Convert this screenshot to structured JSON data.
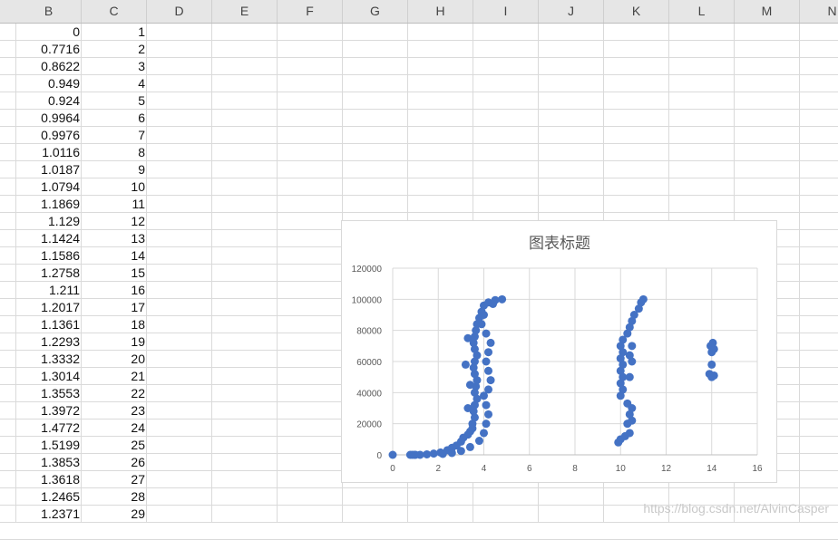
{
  "columns": [
    "B",
    "C",
    "D",
    "E",
    "F",
    "G",
    "H",
    "I",
    "J",
    "K",
    "L",
    "M",
    "N"
  ],
  "rows": [
    {
      "b": "0",
      "c": "1"
    },
    {
      "b": "0.7716",
      "c": "2"
    },
    {
      "b": "0.8622",
      "c": "3"
    },
    {
      "b": "0.949",
      "c": "4"
    },
    {
      "b": "0.924",
      "c": "5"
    },
    {
      "b": "0.9964",
      "c": "6"
    },
    {
      "b": "0.9976",
      "c": "7"
    },
    {
      "b": "1.0116",
      "c": "8"
    },
    {
      "b": "1.0187",
      "c": "9"
    },
    {
      "b": "1.0794",
      "c": "10"
    },
    {
      "b": "1.1869",
      "c": "11"
    },
    {
      "b": "1.129",
      "c": "12"
    },
    {
      "b": "1.1424",
      "c": "13"
    },
    {
      "b": "1.1586",
      "c": "14"
    },
    {
      "b": "1.2758",
      "c": "15"
    },
    {
      "b": "1.211",
      "c": "16"
    },
    {
      "b": "1.2017",
      "c": "17"
    },
    {
      "b": "1.1361",
      "c": "18"
    },
    {
      "b": "1.2293",
      "c": "19"
    },
    {
      "b": "1.3332",
      "c": "20"
    },
    {
      "b": "1.3014",
      "c": "21"
    },
    {
      "b": "1.3553",
      "c": "22"
    },
    {
      "b": "1.3972",
      "c": "23"
    },
    {
      "b": "1.4772",
      "c": "24"
    },
    {
      "b": "1.5199",
      "c": "25"
    },
    {
      "b": "1.3853",
      "c": "26"
    },
    {
      "b": "1.3618",
      "c": "27"
    },
    {
      "b": "1.2465",
      "c": "28"
    },
    {
      "b": "1.2371",
      "c": "29"
    }
  ],
  "chart_data": {
    "type": "scatter",
    "title": "图表标题",
    "xlim": [
      0,
      16
    ],
    "ylim": [
      0,
      120000
    ],
    "x_ticks": [
      "0",
      "2",
      "4",
      "6",
      "8",
      "10",
      "12",
      "14",
      "16"
    ],
    "y_ticks": [
      "0",
      "20000",
      "40000",
      "60000",
      "80000",
      "100000",
      "120000"
    ],
    "grid": true,
    "legend": "none",
    "marker_color": "#4472c4",
    "series": [
      {
        "points": [
          [
            0,
            0
          ],
          [
            0.77,
            1
          ],
          [
            0.86,
            2
          ],
          [
            0.95,
            3
          ],
          [
            1,
            5
          ],
          [
            1.2,
            20
          ],
          [
            1.5,
            300
          ],
          [
            1.8,
            800
          ],
          [
            2.1,
            1500
          ],
          [
            2.4,
            3000
          ],
          [
            2.6,
            4500
          ],
          [
            2.8,
            6000
          ],
          [
            3.0,
            8500
          ],
          [
            3.1,
            11000
          ],
          [
            3.3,
            13000
          ],
          [
            3.4,
            15000
          ],
          [
            3.5,
            17000
          ],
          [
            3.5,
            20000
          ],
          [
            3.6,
            24000
          ],
          [
            3.55,
            28000
          ],
          [
            3.6,
            32000
          ],
          [
            3.7,
            36000
          ],
          [
            3.6,
            40000
          ],
          [
            3.65,
            44000
          ],
          [
            3.7,
            48000
          ],
          [
            3.6,
            52000
          ],
          [
            3.55,
            56000
          ],
          [
            3.6,
            60000
          ],
          [
            3.7,
            64000
          ],
          [
            3.6,
            68000
          ],
          [
            3.55,
            72000
          ],
          [
            3.6,
            76000
          ],
          [
            3.65,
            80000
          ],
          [
            3.7,
            84000
          ],
          [
            3.8,
            88000
          ],
          [
            3.9,
            92000
          ],
          [
            4.0,
            96000
          ],
          [
            4.2,
            98000
          ],
          [
            4.5,
            99500
          ],
          [
            4.8,
            100000
          ],
          [
            2.2,
            600
          ],
          [
            2.6,
            1200
          ],
          [
            3.0,
            2500
          ],
          [
            3.4,
            5000
          ],
          [
            3.8,
            9000
          ],
          [
            4.0,
            14000
          ],
          [
            4.1,
            20000
          ],
          [
            4.2,
            26000
          ],
          [
            4.1,
            32000
          ],
          [
            4.0,
            38000
          ],
          [
            4.2,
            42000
          ],
          [
            4.3,
            48000
          ],
          [
            4.2,
            54000
          ],
          [
            4.1,
            60000
          ],
          [
            4.2,
            66000
          ],
          [
            4.3,
            72000
          ],
          [
            4.1,
            78000
          ],
          [
            3.9,
            84000
          ],
          [
            4.0,
            90000
          ],
          [
            4.4,
            97000
          ],
          [
            3.3,
            30000
          ],
          [
            3.2,
            58000
          ],
          [
            3.4,
            45000
          ],
          [
            3.3,
            75000
          ],
          [
            9.9,
            8000
          ],
          [
            10.0,
            10000
          ],
          [
            10.2,
            12000
          ],
          [
            10.4,
            14000
          ],
          [
            10.3,
            20000
          ],
          [
            10.5,
            22000
          ],
          [
            10.4,
            26000
          ],
          [
            10.5,
            30000
          ],
          [
            10.3,
            33000
          ],
          [
            10.0,
            38000
          ],
          [
            10.1,
            42000
          ],
          [
            10.0,
            46000
          ],
          [
            10.1,
            50000
          ],
          [
            10.0,
            54000
          ],
          [
            10.1,
            58000
          ],
          [
            10.0,
            62000
          ],
          [
            10.1,
            66000
          ],
          [
            10.0,
            70000
          ],
          [
            10.1,
            74000
          ],
          [
            10.3,
            78000
          ],
          [
            10.4,
            82000
          ],
          [
            10.5,
            86000
          ],
          [
            10.6,
            90000
          ],
          [
            10.8,
            94000
          ],
          [
            10.9,
            98000
          ],
          [
            11.0,
            100000
          ],
          [
            10.5,
            60000
          ],
          [
            10.4,
            50000
          ],
          [
            10.5,
            70000
          ],
          [
            10.4,
            64000
          ],
          [
            14.0,
            50000
          ],
          [
            14.1,
            51000
          ],
          [
            13.9,
            52000
          ],
          [
            14.0,
            58000
          ],
          [
            14.0,
            66000
          ],
          [
            14.1,
            68000
          ],
          [
            13.95,
            70000
          ],
          [
            14.05,
            72000
          ]
        ]
      }
    ]
  },
  "watermark": "https://blog.csdn.net/AlvinCasper"
}
